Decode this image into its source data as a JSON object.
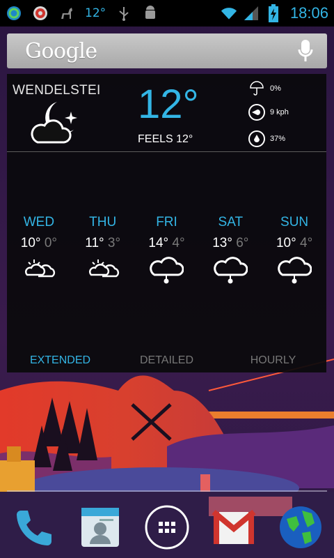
{
  "status_bar": {
    "time": "18:06",
    "temperature": "12°",
    "icons": [
      "sync-icon",
      "lastpass-icon",
      "alpaca-icon",
      "usb-icon",
      "android-debug-icon",
      "wifi-icon",
      "signal-icon",
      "battery-charging-icon"
    ]
  },
  "search": {
    "logo": "Google",
    "mic_icon": "microphone-icon"
  },
  "weather": {
    "location": "WENDELSTEI",
    "current_temp": "12°",
    "feels": "FEELS 12°",
    "condition_icon": "moon-cloud-icon",
    "precipitation": "0%",
    "wind": "9 kph",
    "humidity": "37%",
    "forecast": [
      {
        "day": "WED",
        "high": "10°",
        "low": "0°",
        "icon": "partly-cloudy-icon"
      },
      {
        "day": "THU",
        "high": "11°",
        "low": "3°",
        "icon": "partly-cloudy-icon"
      },
      {
        "day": "FRI",
        "high": "14°",
        "low": "4°",
        "icon": "rain-cloud-icon"
      },
      {
        "day": "SAT",
        "high": "13°",
        "low": "6°",
        "icon": "rain-cloud-icon"
      },
      {
        "day": "SUN",
        "high": "10°",
        "low": "4°",
        "icon": "rain-cloud-icon"
      }
    ],
    "tabs": [
      {
        "label": "EXTENDED",
        "active": true
      },
      {
        "label": "DETAILED",
        "active": false
      },
      {
        "label": "HOURLY",
        "active": false
      }
    ]
  },
  "dock": [
    "phone-icon",
    "contacts-icon",
    "app-drawer-icon",
    "gmail-icon",
    "browser-icon"
  ],
  "colors": {
    "accent": "#33b5e5",
    "muted": "#777777",
    "widget_bg": "#0a0a0c"
  }
}
